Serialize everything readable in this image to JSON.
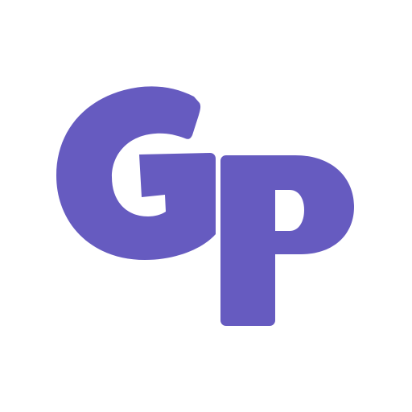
{
  "logo": {
    "text": "Gp",
    "color": "#665BC0",
    "background": "#FFFFFF"
  }
}
